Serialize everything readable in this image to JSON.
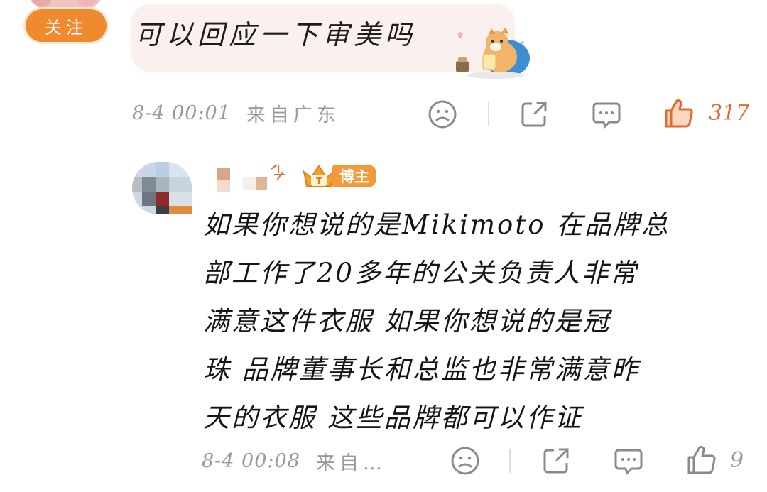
{
  "comment1": {
    "follow_label": "关注",
    "text": "可以回应一下审美吗",
    "time": "8-4 00:01",
    "location": "来自广东",
    "like_count": "317",
    "like_active_color": "#e8682c"
  },
  "comment2": {
    "role_badge": "博主",
    "text_lines": [
      "如果你想说的是Mikimoto 在品牌总",
      "部工作了20多年的公关负责人非常",
      "满意这件衣服 如果你想说的是冠",
      "珠 品牌董事长和总监也非常满意昨",
      "天的衣服 这些品牌都可以作证"
    ],
    "time": "8-4 00:08",
    "location": "来自…",
    "like_count": "9"
  },
  "icons": {
    "dislike": "neutral-face-icon",
    "share": "share-icon",
    "reply": "comment-icon",
    "like": "thumbs-up-icon"
  },
  "colors": {
    "accent": "#f08a2e",
    "meta_grey": "#9a9a9a",
    "bubble_bg": "#faf1ef"
  }
}
